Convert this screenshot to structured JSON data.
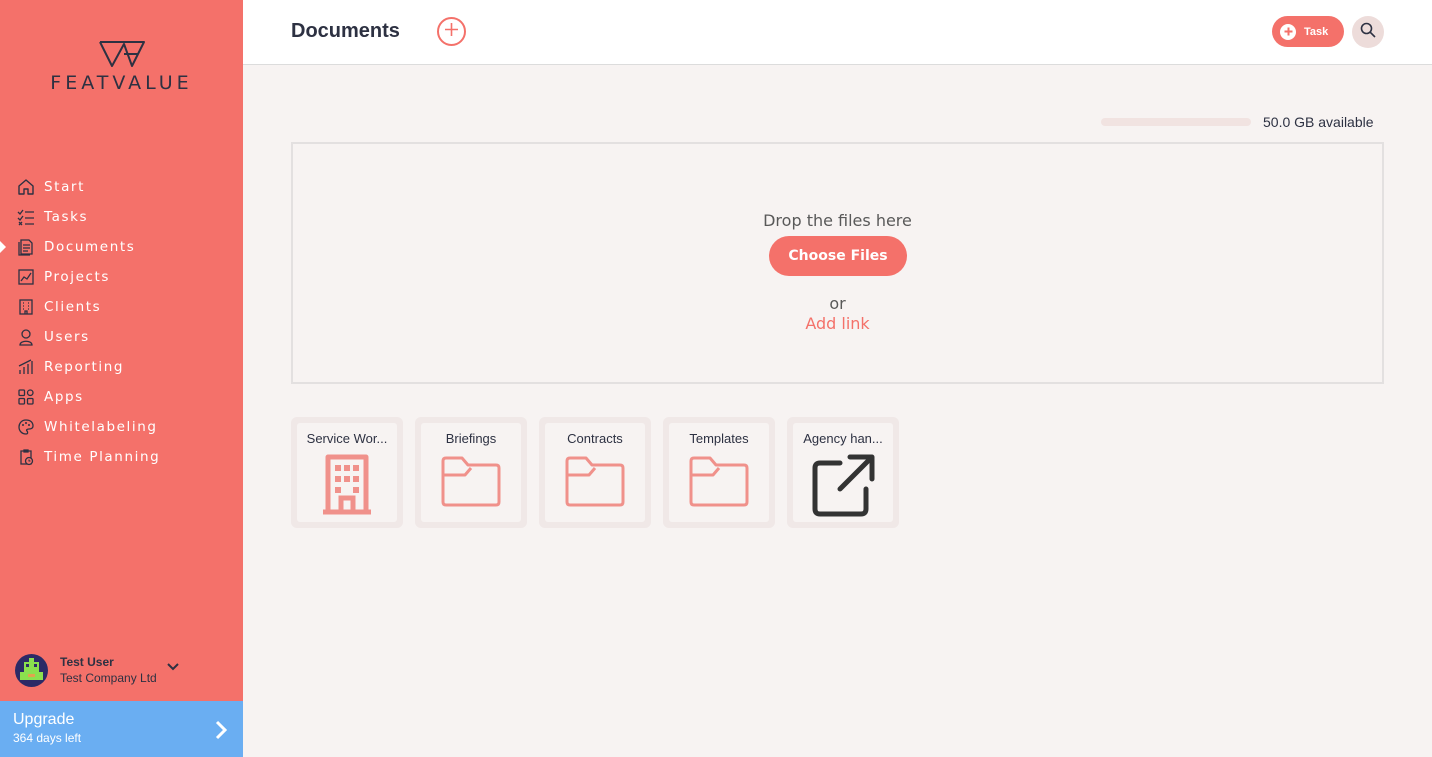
{
  "brand": {
    "name": "FEATVALUE"
  },
  "sidebar": {
    "items": [
      {
        "label": "Start",
        "icon": "home-icon",
        "active": false
      },
      {
        "label": "Tasks",
        "icon": "checklist-icon",
        "active": false
      },
      {
        "label": "Documents",
        "icon": "document-icon",
        "active": true
      },
      {
        "label": "Projects",
        "icon": "chart-icon",
        "active": false
      },
      {
        "label": "Clients",
        "icon": "building-icon",
        "active": false
      },
      {
        "label": "Users",
        "icon": "user-icon",
        "active": false
      },
      {
        "label": "Reporting",
        "icon": "bar-chart-icon",
        "active": false
      },
      {
        "label": "Apps",
        "icon": "apps-icon",
        "active": false
      },
      {
        "label": "Whitelabeling",
        "icon": "palette-icon",
        "active": false
      },
      {
        "label": "Time Planning",
        "icon": "clipboard-clock-icon",
        "active": false
      }
    ],
    "user": {
      "name": "Test User",
      "company": "Test Company Ltd"
    },
    "upgrade": {
      "title": "Upgrade",
      "subtitle": "364 days left"
    }
  },
  "header": {
    "title": "Documents",
    "task_label": "Task"
  },
  "storage": {
    "text": "50.0 GB available",
    "used_fraction": 0
  },
  "dropzone": {
    "prompt": "Drop the files here",
    "choose_label": "Choose Files",
    "or_label": "or",
    "link_label": "Add link"
  },
  "folders": [
    {
      "name": "Service Wor...",
      "icon": "building-icon"
    },
    {
      "name": "Briefings",
      "icon": "folder-icon"
    },
    {
      "name": "Contracts",
      "icon": "folder-icon"
    },
    {
      "name": "Templates",
      "icon": "folder-icon"
    },
    {
      "name": "Agency han...",
      "icon": "external-link-icon"
    }
  ],
  "colors": {
    "accent": "#f4716a",
    "sidebar_bg": "#f4716a",
    "upgrade_bg": "#6aaef2",
    "text_dark": "#2d3142",
    "content_bg": "#f7f3f2"
  }
}
